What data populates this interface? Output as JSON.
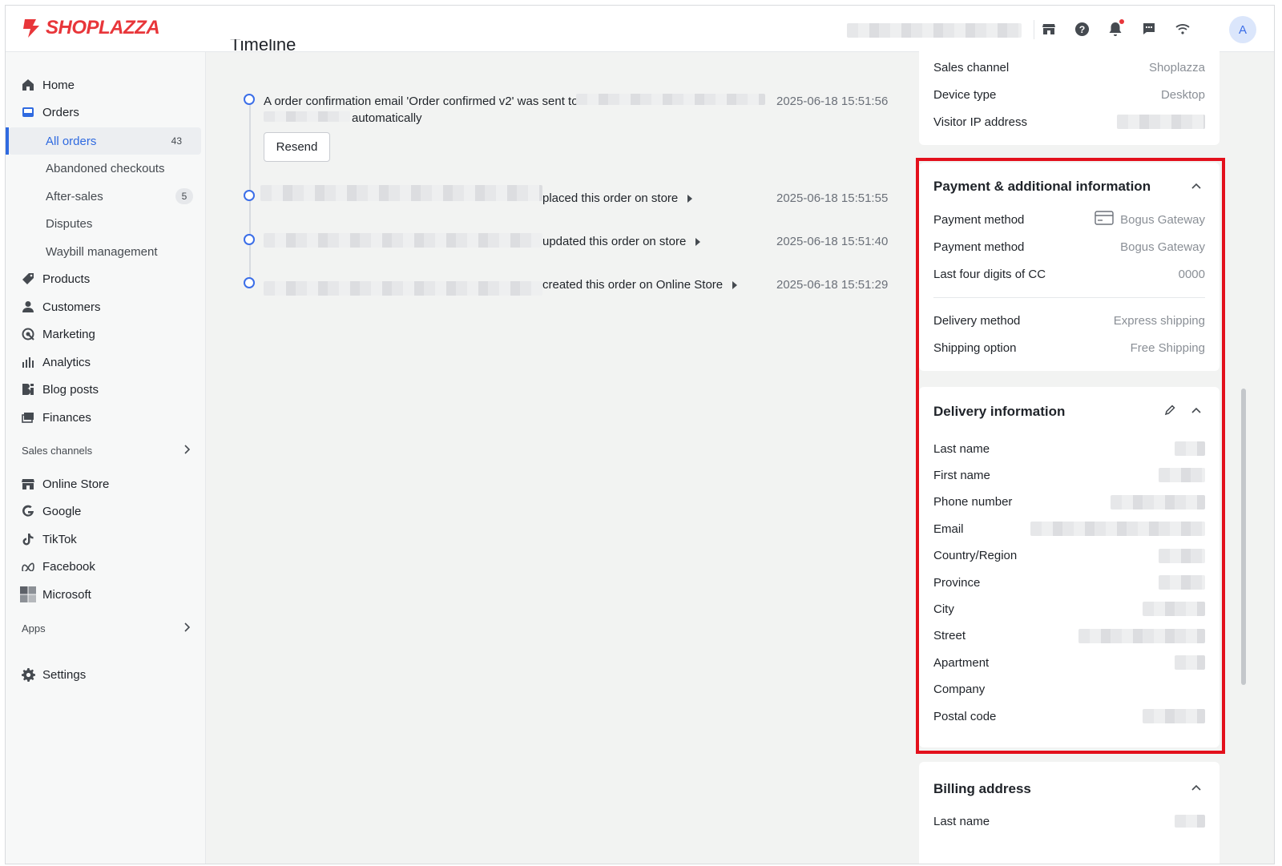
{
  "brand": {
    "name": "SHOPLAZZA",
    "color": "#e8363a"
  },
  "topbar": {
    "icons": [
      "store-icon",
      "help-icon",
      "bell-icon",
      "chat-icon",
      "wifi-icon"
    ],
    "avatar_letter": "A"
  },
  "sidebar": {
    "items": [
      {
        "label": "Home",
        "icon": "home-icon"
      },
      {
        "label": "Orders",
        "icon": "orders-icon"
      },
      {
        "label": "All orders",
        "badge": "43",
        "active": true
      },
      {
        "label": "Abandoned checkouts"
      },
      {
        "label": "After-sales",
        "badge": "5"
      },
      {
        "label": "Disputes"
      },
      {
        "label": "Waybill management"
      },
      {
        "label": "Products",
        "icon": "tag-icon"
      },
      {
        "label": "Customers",
        "icon": "person-icon"
      },
      {
        "label": "Marketing",
        "icon": "marketing-icon"
      },
      {
        "label": "Analytics",
        "icon": "bar-chart-icon"
      },
      {
        "label": "Blog posts",
        "icon": "blog-icon"
      },
      {
        "label": "Finances",
        "icon": "finance-icon"
      }
    ],
    "sales_channels_label": "Sales channels",
    "channels": [
      {
        "label": "Online Store",
        "icon": "store-icon"
      },
      {
        "label": "Google",
        "icon": "google-icon"
      },
      {
        "label": "TikTok",
        "icon": "tiktok-icon"
      },
      {
        "label": "Facebook",
        "icon": "meta-icon"
      },
      {
        "label": "Microsoft",
        "icon": "microsoft-icon"
      }
    ],
    "apps_label": "Apps",
    "settings_label": "Settings"
  },
  "timeline": {
    "title": "Timeline",
    "events": [
      {
        "text": "A order confirmation email 'Order confirmed v2' was sent to",
        "text2": "automatically",
        "time": "2025-06-18 15:51:56",
        "button": "Resend"
      },
      {
        "text": "placed this order on store",
        "time": "2025-06-18 15:51:55"
      },
      {
        "text": "updated this order on store",
        "time": "2025-06-18 15:51:40"
      },
      {
        "text": "created this order on Online Store",
        "time": "2025-06-18 15:51:29"
      }
    ]
  },
  "details": {
    "rows": [
      {
        "k": "Sales channel",
        "v": "Shoplazza"
      },
      {
        "k": "Device type",
        "v": "Desktop"
      },
      {
        "k": "Visitor IP address",
        "v": ""
      }
    ]
  },
  "payment": {
    "title": "Payment & additional information",
    "rows": [
      {
        "k": "Payment method",
        "v": "Bogus Gateway",
        "icon": "credit-card-icon"
      },
      {
        "k": "Payment method",
        "v": "Bogus Gateway"
      },
      {
        "k": "Last four digits of CC",
        "v": "0000"
      }
    ],
    "rows2": [
      {
        "k": "Delivery method",
        "v": "Express shipping"
      },
      {
        "k": "Shipping option",
        "v": "Free Shipping"
      }
    ]
  },
  "delivery": {
    "title": "Delivery information",
    "fields": [
      "Last name",
      "First name",
      "Phone number",
      "Email",
      "Country/Region",
      "Province",
      "City",
      "Street",
      "Apartment",
      "Company",
      "Postal code"
    ]
  },
  "billing": {
    "title": "Billing address",
    "fields": [
      "Last name"
    ]
  }
}
